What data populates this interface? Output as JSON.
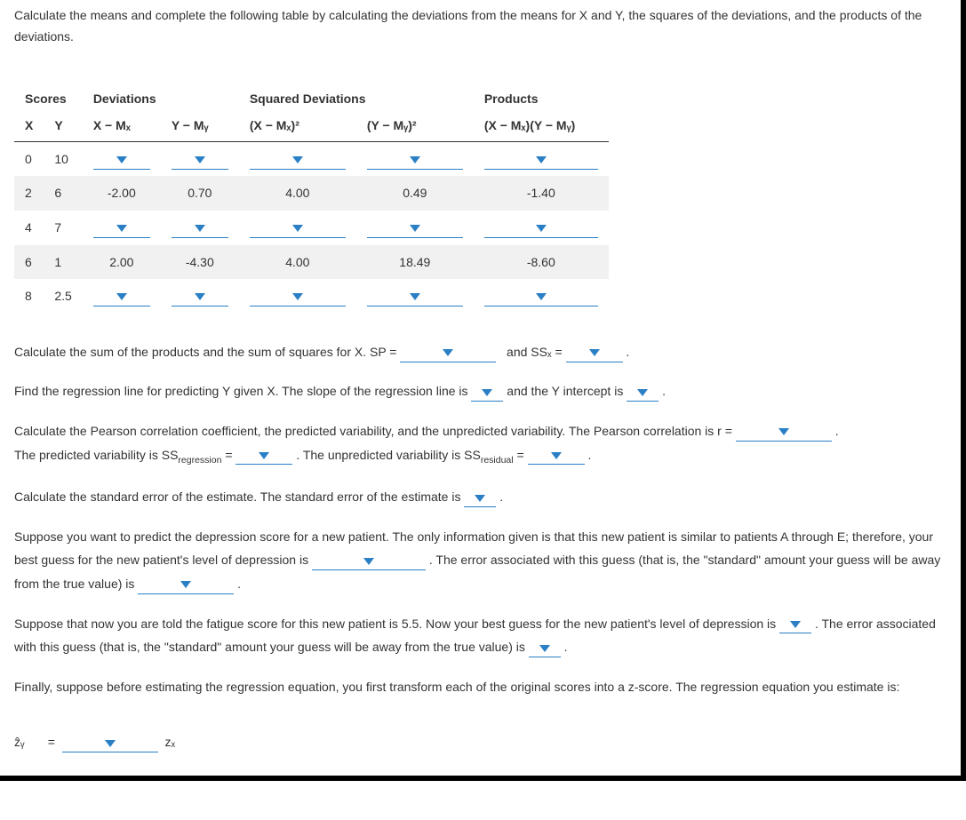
{
  "intro": "Calculate the means and complete the following table by calculating the deviations from the means for X and Y, the squares of the deviations, and the products of the deviations.",
  "table": {
    "group_headers": {
      "scores": "Scores",
      "deviations": "Deviations",
      "sqdev": "Squared Deviations",
      "products": "Products"
    },
    "col_headers": {
      "x": "X",
      "y": "Y",
      "xdev": "X − Mₓ",
      "ydev": "Y − Mᵧ",
      "xdev2": "(X − Mₓ)²",
      "ydev2": "(Y − Mᵧ)²",
      "prod": "(X − Mₓ)(Y − Mᵧ)"
    },
    "rows": [
      {
        "x": "0",
        "y": "10",
        "xdev": "",
        "ydev": "",
        "xdev2": "",
        "ydev2": "",
        "prod": ""
      },
      {
        "x": "2",
        "y": "6",
        "xdev": "-2.00",
        "ydev": "0.70",
        "xdev2": "4.00",
        "ydev2": "0.49",
        "prod": "-1.40"
      },
      {
        "x": "4",
        "y": "7",
        "xdev": "",
        "ydev": "",
        "xdev2": "",
        "ydev2": "",
        "prod": ""
      },
      {
        "x": "6",
        "y": "1",
        "xdev": "2.00",
        "ydev": "-4.30",
        "xdev2": "4.00",
        "ydev2": "18.49",
        "prod": "-8.60"
      },
      {
        "x": "8",
        "y": "2.5",
        "xdev": "",
        "ydev": "",
        "xdev2": "",
        "ydev2": "",
        "prod": ""
      }
    ]
  },
  "q_sp_ss": {
    "pre": "Calculate the sum of the products and the sum of squares for X. SP =",
    "mid": "and SSₓ =",
    "end": "."
  },
  "q_reg": {
    "pre": "Find the regression line for predicting Y given X. The slope of the regression line is",
    "mid": "and the Y intercept is",
    "end": "."
  },
  "q_pearson": {
    "p1a": "Calculate the Pearson correlation coefficient, the predicted variability, and the unpredicted variability. The Pearson correlation is r =",
    "p1b": ".",
    "p2a": "The predicted variability is SS",
    "p2a_sub": "regression",
    "p2b": " =",
    "p2c": ". The unpredicted variability is SS",
    "p2c_sub": "residual",
    "p2d": " =",
    "p2e": "."
  },
  "q_se": {
    "pre": "Calculate the standard error of the estimate. The standard error of the estimate is",
    "end": "."
  },
  "q_newpatient": {
    "l1": "Suppose you want to predict the depression score for a new patient. The only information given is that this new patient is similar to patients A through E; therefore, your best guess for the new patient's level of depression is",
    "l2": ". The error associated with this guess (that is, the \"standard\" amount your guess will be away from the true value) is",
    "l3": "."
  },
  "q_fatigue": {
    "l1": "Suppose that now you are told the fatigue score for this new patient is 5.5. Now your best guess for the new patient's level of depression is",
    "l2": ". The error associated with this guess (that is, the \"standard\" amount your guess will be away from the true value) is",
    "l3": "."
  },
  "q_zscore": {
    "text": "Finally, suppose before estimating the regression equation, you first transform each of the original scores into a z-score. The regression equation you estimate is:",
    "lhs": "ẑᵧ",
    "eq": "=",
    "rhs": "zₓ"
  }
}
